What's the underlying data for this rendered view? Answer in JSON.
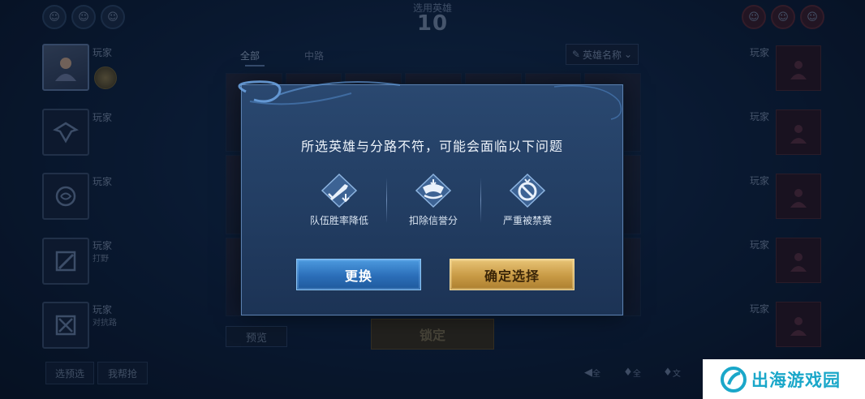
{
  "header": {
    "title": "选用英雄",
    "countdown": "10"
  },
  "left_team": [
    {
      "name": "玩家",
      "role": ""
    },
    {
      "name": "玩家",
      "role": ""
    },
    {
      "name": "玩家",
      "role": ""
    },
    {
      "name": "玩家",
      "role": "打野"
    },
    {
      "name": "玩家",
      "role": "对抗路"
    }
  ],
  "right_team": [
    "玩家",
    "玩家",
    "玩家",
    "玩家",
    "玩家"
  ],
  "tabs": [
    {
      "label": "全部"
    },
    {
      "label": "中路"
    }
  ],
  "hero_filter": {
    "label": "英雄名称"
  },
  "buttons": {
    "preview": "预览",
    "lock": "锁定",
    "preselect": "选预选",
    "help_pick": "我帮抢"
  },
  "voice_controls": {
    "speaker": "全",
    "mic": "全",
    "mic_team": "文"
  },
  "modal": {
    "title": "所选英雄与分路不符，可能会面临以下问题",
    "penalties": [
      {
        "label": "队伍胜率降低",
        "icon": "sword-down-icon"
      },
      {
        "label": "扣除信誉分",
        "icon": "credit-deduct-icon"
      },
      {
        "label": "严重被禁赛",
        "icon": "ban-icon"
      }
    ],
    "change_button": "更换",
    "confirm_button": "确定选择"
  },
  "watermark": {
    "text": "出海游戏园"
  },
  "colors": {
    "accent_blue": "#2b6eb8",
    "accent_gold": "#c89a45",
    "modal_bg": "#223d62",
    "watermark": "#1aa7c9"
  }
}
